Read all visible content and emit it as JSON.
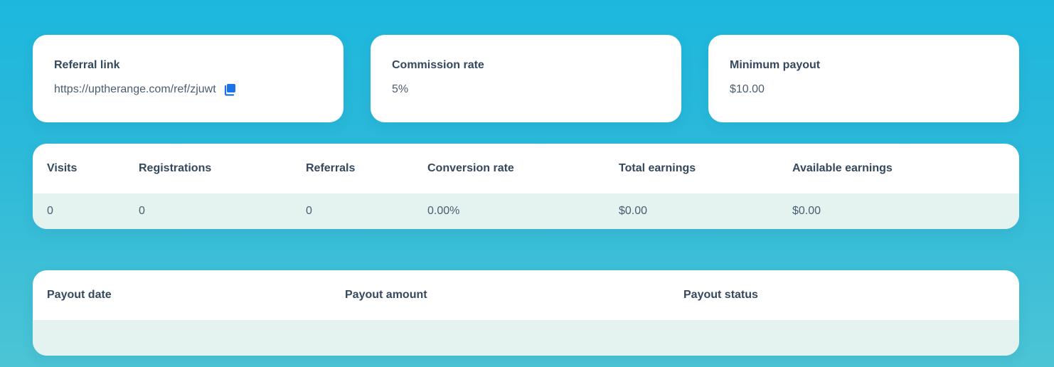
{
  "info_cards": [
    {
      "title": "Referral link",
      "value": "https://uptherange.com/ref/zjuwt",
      "icon": "copy-icon"
    },
    {
      "title": "Commission rate",
      "value": "5%"
    },
    {
      "title": "Minimum payout",
      "value": "$10.00"
    }
  ],
  "stats_table": {
    "headers": [
      "Visits",
      "Registrations",
      "Referrals",
      "Conversion rate",
      "Total earnings",
      "Available earnings"
    ],
    "row": [
      "0",
      "0",
      "0",
      "0.00%",
      "$0.00",
      "$0.00"
    ]
  },
  "payouts_table": {
    "headers": [
      "Payout date",
      "Payout amount",
      "Payout status"
    ],
    "rows": []
  },
  "colors": {
    "background_top": "#1db7de",
    "background_bottom": "#4cc4d6",
    "card": "#ffffff",
    "row_tint": "#e5f3f0",
    "text": "#34495e",
    "accent": "#1a73e8"
  }
}
